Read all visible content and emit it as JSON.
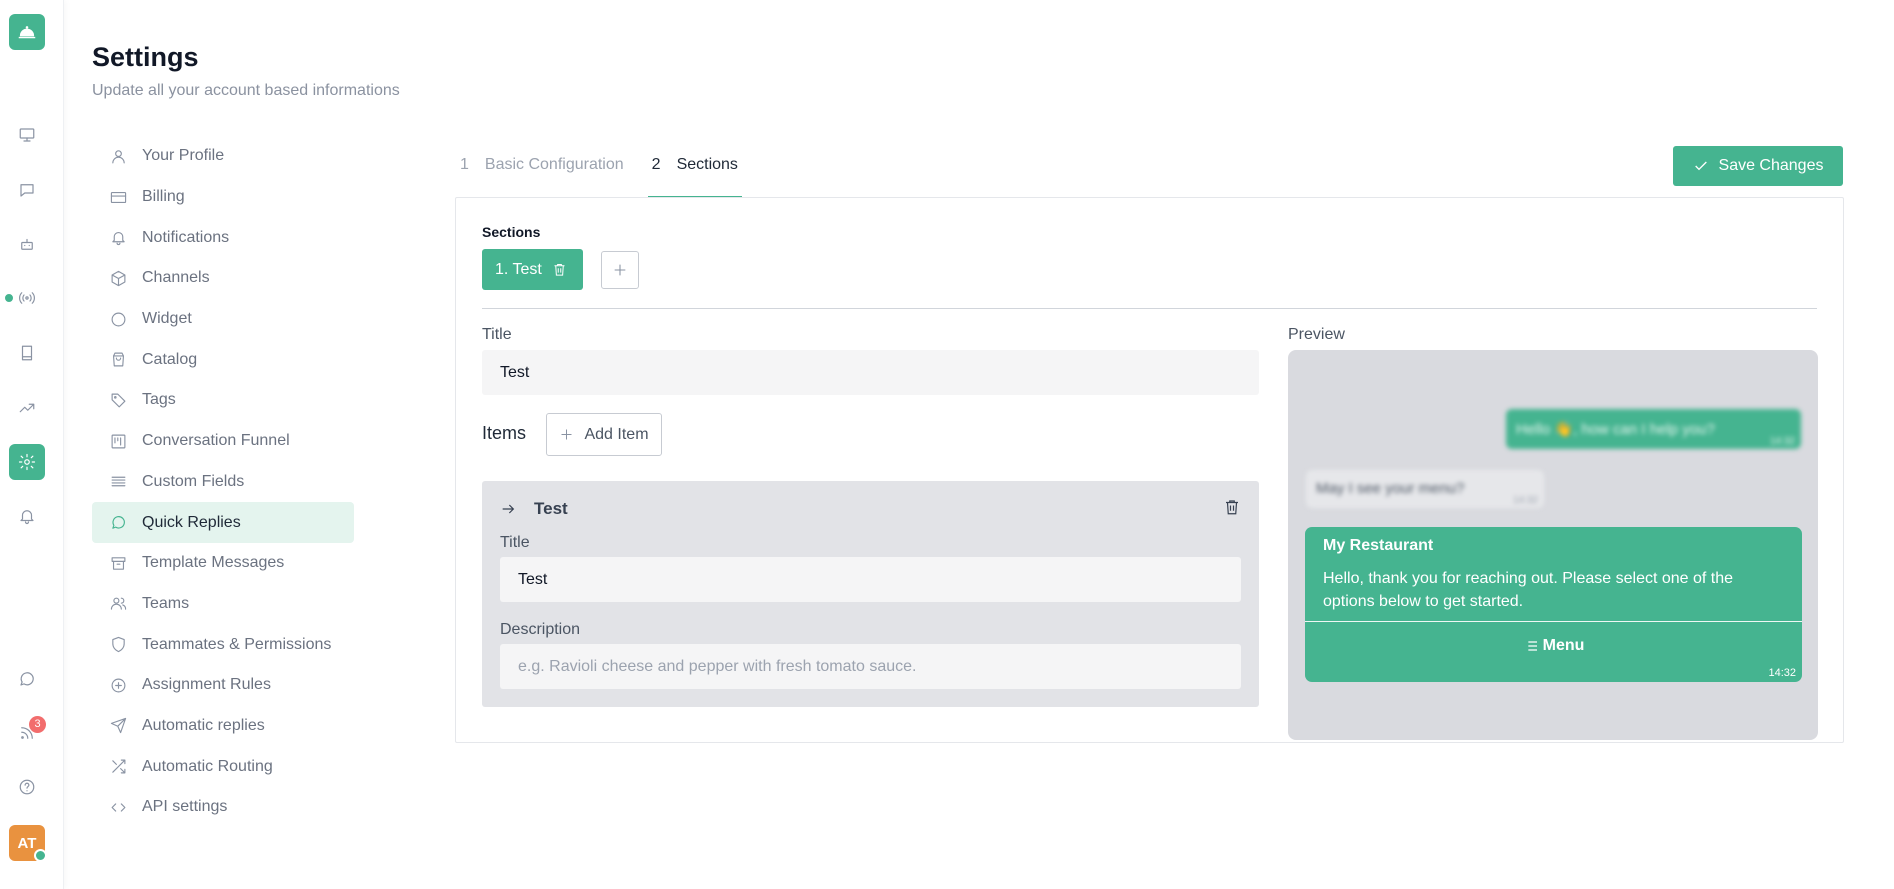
{
  "rail": {
    "icons": [
      "bell-service-logo-icon",
      "monitor-icon",
      "chat-icon",
      "bot-icon",
      "broadcast-icon",
      "book-icon",
      "trending-icon",
      "gear-icon",
      "bell-icon",
      "whatsapp-icon",
      "feed-icon",
      "help-icon"
    ],
    "feed_badge": "3",
    "avatar_initials": "AT"
  },
  "header": {
    "title": "Settings",
    "subtitle": "Update all your account based informations"
  },
  "menu": {
    "items": [
      {
        "label": "Your Profile",
        "icon": "user-icon"
      },
      {
        "label": "Billing",
        "icon": "credit-card-icon"
      },
      {
        "label": "Notifications",
        "icon": "bell-icon"
      },
      {
        "label": "Channels",
        "icon": "box-icon"
      },
      {
        "label": "Widget",
        "icon": "circle-icon"
      },
      {
        "label": "Catalog",
        "icon": "shopping-bag-icon"
      },
      {
        "label": "Tags",
        "icon": "tag-icon"
      },
      {
        "label": "Conversation Funnel",
        "icon": "funnel-icon"
      },
      {
        "label": "Custom Fields",
        "icon": "list-icon"
      },
      {
        "label": "Quick Replies",
        "icon": "message-circle-icon",
        "active": true
      },
      {
        "label": "Template Messages",
        "icon": "archive-icon"
      },
      {
        "label": "Teams",
        "icon": "users-icon"
      },
      {
        "label": "Teammates & Permissions",
        "icon": "shield-icon"
      },
      {
        "label": "Assignment Rules",
        "icon": "plus-circle-icon"
      },
      {
        "label": "Automatic replies",
        "icon": "send-icon"
      },
      {
        "label": "Automatic Routing",
        "icon": "shuffle-icon"
      },
      {
        "label": "API settings",
        "icon": "code-icon"
      }
    ]
  },
  "tabs": [
    {
      "num": "1",
      "label": "Basic Configuration",
      "active": false
    },
    {
      "num": "2",
      "label": "Sections",
      "active": true
    }
  ],
  "toolbar": {
    "save_label": "Save Changes"
  },
  "sections": {
    "label": "Sections",
    "chips": [
      "1. Test"
    ]
  },
  "form": {
    "title_label": "Title",
    "title_value": "Test",
    "items_label": "Items",
    "add_item_label": "Add Item"
  },
  "item": {
    "name": "Test",
    "title_label": "Title",
    "title_value": "Test",
    "description_label": "Description",
    "description_value": "",
    "description_placeholder": "e.g. Ravioli cheese and pepper with fresh tomato sauce."
  },
  "preview": {
    "label": "Preview",
    "outgoing_text": "Hello 👋, how can I help you?",
    "outgoing_time": "14:32",
    "incoming_text": "May I see your menu?",
    "incoming_time": "14:32",
    "menu_title": "My Restaurant",
    "menu_body": "Hello, thank you for reaching out. Please select one of the options below to get started.",
    "menu_button": "Menu",
    "menu_time": "14:32"
  },
  "colors": {
    "accent": "#45b490",
    "active_menu_bg": "#e4f4ee",
    "badge": "#f26d6d",
    "avatar": "#e9923f"
  }
}
